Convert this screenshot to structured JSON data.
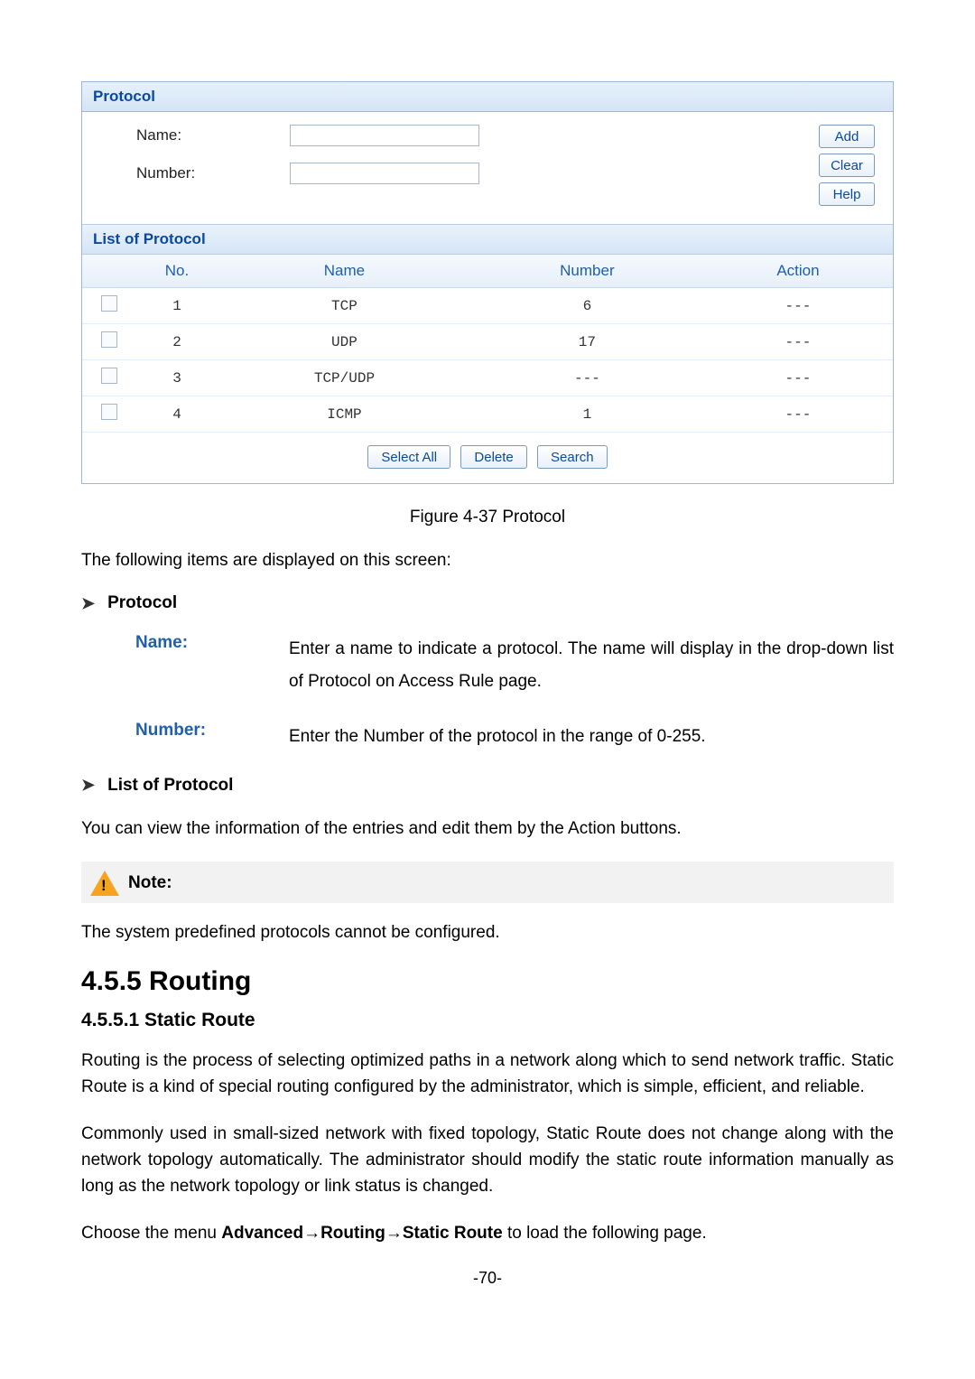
{
  "panel": {
    "title": "Protocol",
    "name_label": "Name:",
    "number_label": "Number:",
    "name_value": "",
    "number_value": "",
    "btn_add": "Add",
    "btn_clear": "Clear",
    "btn_help": "Help",
    "list_title": "List of Protocol",
    "columns": {
      "no": "No.",
      "name": "Name",
      "number": "Number",
      "action": "Action"
    },
    "rows": [
      {
        "no": "1",
        "name": "TCP",
        "number": "6",
        "action": "---"
      },
      {
        "no": "2",
        "name": "UDP",
        "number": "17",
        "action": "---"
      },
      {
        "no": "3",
        "name": "TCP/UDP",
        "number": "---",
        "action": "---"
      },
      {
        "no": "4",
        "name": "ICMP",
        "number": "1",
        "action": "---"
      }
    ],
    "btn_select_all": "Select All",
    "btn_delete": "Delete",
    "btn_search": "Search"
  },
  "figure_caption": "Figure 4-37 Protocol",
  "intro_line": "The following items are displayed on this screen:",
  "bullets": {
    "protocol": "Protocol",
    "list_of_protocol": "List of Protocol"
  },
  "defs": {
    "name_term": "Name:",
    "name_desc": "Enter a name to indicate a protocol. The name will display in the drop-down list of Protocol on Access Rule page.",
    "number_term": "Number:",
    "number_desc": "Enter the Number of the protocol in the range of 0-255."
  },
  "list_para": "You can view the information of the entries and edit them by the Action buttons.",
  "note": {
    "label": "Note:",
    "text": "The system predefined protocols cannot be configured."
  },
  "sec_routing": "4.5.5  Routing",
  "subsec_static": "4.5.5.1    Static Route",
  "routing_para1": "Routing is the process of selecting optimized paths in a network along which to send network traffic. Static Route is a kind of special routing configured by the administrator, which is simple, efficient, and reliable.",
  "routing_para2": "Commonly used in small-sized network with fixed topology, Static Route does not change along with the network topology automatically. The administrator should modify the static route information manually as long as the network topology or link status is changed.",
  "menu_prefix": "Choose the menu ",
  "menu_bold": "Advanced→Routing→Static Route",
  "menu_suffix": " to load the following page.",
  "page_number": "-70-"
}
